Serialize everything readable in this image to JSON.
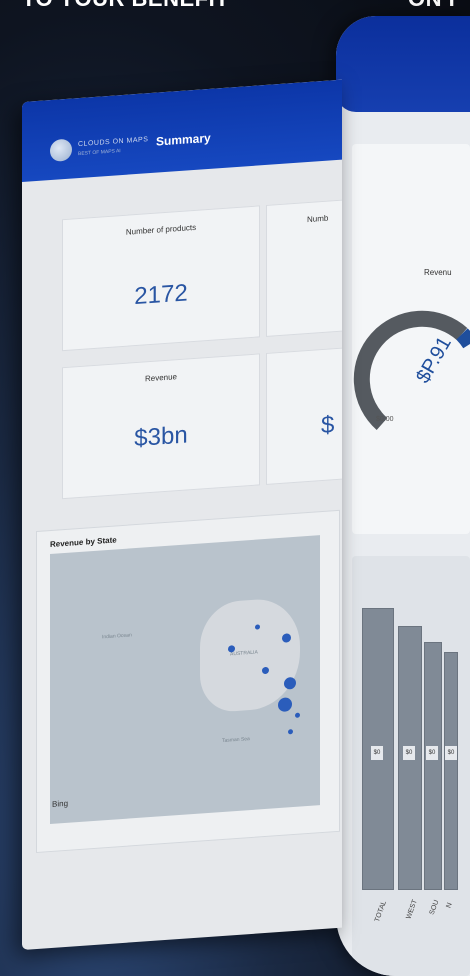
{
  "banner": {
    "left_text": "TO YOUR BENEFIT",
    "right_text": "ON I"
  },
  "report": {
    "logo_text": "CLOUDS ON MAPS",
    "logo_subtext": "BEST OF MAPS AI",
    "page_title": "Summary",
    "cards": [
      {
        "label": "Number of products",
        "value": "2172"
      },
      {
        "label": "Numb",
        "value": ""
      },
      {
        "label": "Revenue",
        "value": "$3bn"
      },
      {
        "label": "",
        "value": "$"
      }
    ],
    "map": {
      "title": "Revenue by State",
      "land_label": "AUSTRALIA",
      "sea_label_1": "Indian Ocean",
      "sea_label_2": "Tasman Sea",
      "provider": "Bing"
    }
  },
  "right_panel": {
    "gauge": {
      "title": "Revenu",
      "value": "$P.91",
      "min_label": "$0.00"
    },
    "bars": {
      "labels": [
        "$0",
        "$0",
        "$0",
        "$0"
      ],
      "axis": [
        "TOTAL",
        "WEST",
        "SOU",
        "N"
      ]
    }
  },
  "colors": {
    "accent": "#1648c0",
    "value_text": "#2955a3",
    "dot": "#2b5dbb"
  }
}
